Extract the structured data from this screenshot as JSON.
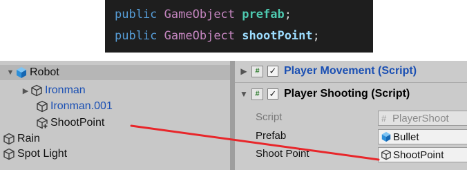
{
  "code": {
    "line1": {
      "keyword": "public",
      "type": "GameObject",
      "name": "prefab",
      "end": ";"
    },
    "line2": {
      "keyword": "public",
      "type": "GameObject",
      "name": "shootPoint",
      "end": ";"
    }
  },
  "hierarchy": {
    "items": [
      {
        "label": "Robot",
        "icon": "prefab-cube-icon",
        "expanded": true
      },
      {
        "label": "Ironman",
        "icon": "cube-outline-icon",
        "expanded": false
      },
      {
        "label": "Ironman.001",
        "icon": "cube-outline-icon"
      },
      {
        "label": "ShootPoint",
        "icon": "cube-outline-icon"
      },
      {
        "label": "Rain",
        "icon": "cube-outline-icon"
      },
      {
        "label": "Spot Light",
        "icon": "cube-outline-icon"
      }
    ]
  },
  "inspector": {
    "components": [
      {
        "title": "Player Movement (Script)",
        "enabled": true,
        "expanded": false
      },
      {
        "title": "Player Shooting (Script)",
        "enabled": true,
        "expanded": true
      }
    ],
    "properties": {
      "script": {
        "label": "Script",
        "value": "PlayerShoot"
      },
      "prefab": {
        "label": "Prefab",
        "value": "Bullet"
      },
      "shoot_point": {
        "label": "Shoot Point",
        "value": "ShootPoint"
      }
    }
  },
  "annotation": {
    "arrow_color": "#e8262a"
  },
  "colors": {
    "code_bg": "#1e1e1e",
    "link_blue": "#1a4fb3",
    "panel_bg": "#c8c8c8"
  }
}
